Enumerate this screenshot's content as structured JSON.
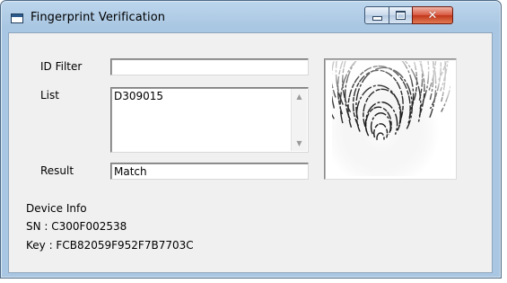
{
  "window": {
    "title": "Fingerprint Verification",
    "close_glyph": "✕"
  },
  "form": {
    "id_filter_label": "ID Filter",
    "id_filter_value": "",
    "list_label": "List",
    "list_items": [
      "D309015"
    ],
    "result_label": "Result",
    "result_value": "Match"
  },
  "device": {
    "heading": "Device Info",
    "sn_line": "SN  : C300F002538",
    "key_line": "Key : FCB82059F952F7B7703C"
  },
  "icons": {
    "app": "window-app-icon",
    "minimize": "minimize-icon",
    "maximize": "maximize-icon",
    "close": "close-icon",
    "scroll_up": "scroll-up-arrow-icon",
    "scroll_down": "scroll-down-arrow-icon"
  },
  "colors": {
    "frame": "#a9c6e2",
    "client": "#f0f0f0",
    "close_button": "#c2371c"
  }
}
